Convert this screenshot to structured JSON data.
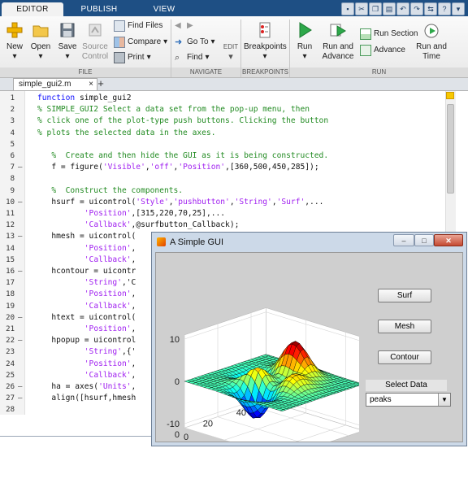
{
  "ribbon": {
    "tabs": [
      "EDITOR",
      "PUBLISH",
      "VIEW"
    ],
    "active_tab": "EDITOR",
    "file_group": {
      "new": "New",
      "open": "Open",
      "save": "Save",
      "source_control": "Source Control",
      "find_files": "Find Files",
      "compare": "Compare",
      "print": "Print"
    },
    "edit_group": {
      "go_to": "Go To",
      "find": "Find",
      "edit": "EDIT"
    },
    "breakpoints_group": {
      "breakpoints": "Breakpoints"
    },
    "run_group": {
      "run": "Run",
      "run_and_advance": "Run and Advance",
      "run_section": "Run Section",
      "advance": "Advance",
      "run_and_time": "Run and Time"
    },
    "group_labels": {
      "file": "FILE",
      "navigate": "NAVIGATE",
      "breakpoints": "BREAKPOINTS",
      "run": "RUN"
    }
  },
  "editor": {
    "tab_name": "simple_gui2.m",
    "tab_close": "×",
    "new_tab": "+",
    "lines": [
      {
        "n": "1",
        "bp": "",
        "code": "function simple_gui2"
      },
      {
        "n": "2",
        "bp": "",
        "code": "% SIMPLE_GUI2 Select a data set from the pop-up menu, then"
      },
      {
        "n": "3",
        "bp": "",
        "code": "% click one of the plot-type push buttons. Clicking the button"
      },
      {
        "n": "4",
        "bp": "",
        "code": "% plots the selected data in the axes."
      },
      {
        "n": "5",
        "bp": "",
        "code": ""
      },
      {
        "n": "6",
        "bp": "",
        "code": "   %  Create and then hide the GUI as it is being constructed."
      },
      {
        "n": "7",
        "bp": "–",
        "code": "   f = figure('Visible','off','Position',[360,500,450,285]);"
      },
      {
        "n": "8",
        "bp": "",
        "code": ""
      },
      {
        "n": "9",
        "bp": "",
        "code": "   %  Construct the components."
      },
      {
        "n": "10",
        "bp": "–",
        "code": "   hsurf = uicontrol('Style','pushbutton','String','Surf',..."
      },
      {
        "n": "11",
        "bp": "",
        "code": "          'Position',[315,220,70,25],..."
      },
      {
        "n": "12",
        "bp": "",
        "code": "          'Callback',@surfbutton_Callback);"
      },
      {
        "n": "13",
        "bp": "–",
        "code": "   hmesh = uicontrol("
      },
      {
        "n": "14",
        "bp": "",
        "code": "          'Position',"
      },
      {
        "n": "15",
        "bp": "",
        "code": "          'Callback',"
      },
      {
        "n": "16",
        "bp": "–",
        "code": "   hcontour = uicontr"
      },
      {
        "n": "17",
        "bp": "",
        "code": "          'String','C"
      },
      {
        "n": "18",
        "bp": "",
        "code": "          'Position',"
      },
      {
        "n": "19",
        "bp": "",
        "code": "          'Callback',"
      },
      {
        "n": "20",
        "bp": "–",
        "code": "   htext = uicontrol("
      },
      {
        "n": "21",
        "bp": "",
        "code": "          'Position',"
      },
      {
        "n": "22",
        "bp": "–",
        "code": "   hpopup = uicontrol"
      },
      {
        "n": "23",
        "bp": "",
        "code": "          'String',{'"
      },
      {
        "n": "24",
        "bp": "",
        "code": "          'Position',"
      },
      {
        "n": "25",
        "bp": "",
        "code": "          'Callback',"
      },
      {
        "n": "26",
        "bp": "–",
        "code": "   ha = axes('Units',"
      },
      {
        "n": "27",
        "bp": "–",
        "code": "   align([hsurf,hmesh"
      },
      {
        "n": "28",
        "bp": "",
        "code": ""
      }
    ]
  },
  "figure": {
    "title": "A Simple GUI",
    "window_buttons": [
      "–",
      "□",
      "✕"
    ],
    "buttons": {
      "surf": "Surf",
      "mesh": "Mesh",
      "contour": "Contour"
    },
    "select_label": "Select Data",
    "popup_value": "peaks",
    "popup_arrow": "▼",
    "axes": {
      "z_ticks": [
        "10",
        "0",
        "-10"
      ],
      "x_ticks": [
        "0",
        "20",
        "40"
      ],
      "y_ticks": [
        "40",
        "20",
        "0"
      ]
    }
  }
}
